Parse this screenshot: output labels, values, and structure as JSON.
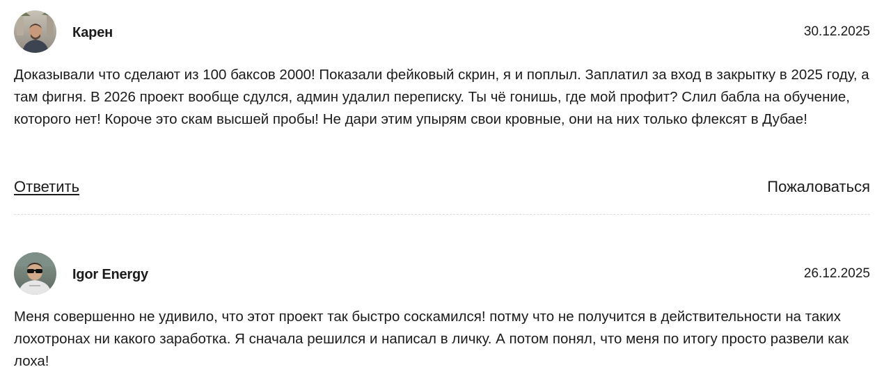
{
  "comments": [
    {
      "author": "Карен",
      "date": "30.12.2025",
      "avatar_icon": "user-photo-avatar",
      "text": "Доказывали что сделают из 100 баксов 2000! Показали фейковый скрин, я и поплыл. Заплатил за вход в закрытку в 2025 году, а там фигня. В 2026 проект вообще сдулся, админ удалил переписку. Ты чё гонишь, где мой профит? Слил бабла на обучение, которого нет! Короче это скам высшей пробы! Не дари этим упырям свои кровные, они на них только флексят в Дубае!",
      "reply_label": "Ответить",
      "report_label": "Пожаловаться"
    },
    {
      "author": "Igor Energy",
      "date": "26.12.2025",
      "avatar_icon": "user-photo-avatar",
      "text": "Меня совершенно не удивило, что этот проект так быстро соскамился! потму что не получится в действительности на таких лохотронах ни какого заработка. Я сначала решился и написал в личку. А потом понял, что меня по итогу просто развели как лоха!"
    }
  ]
}
